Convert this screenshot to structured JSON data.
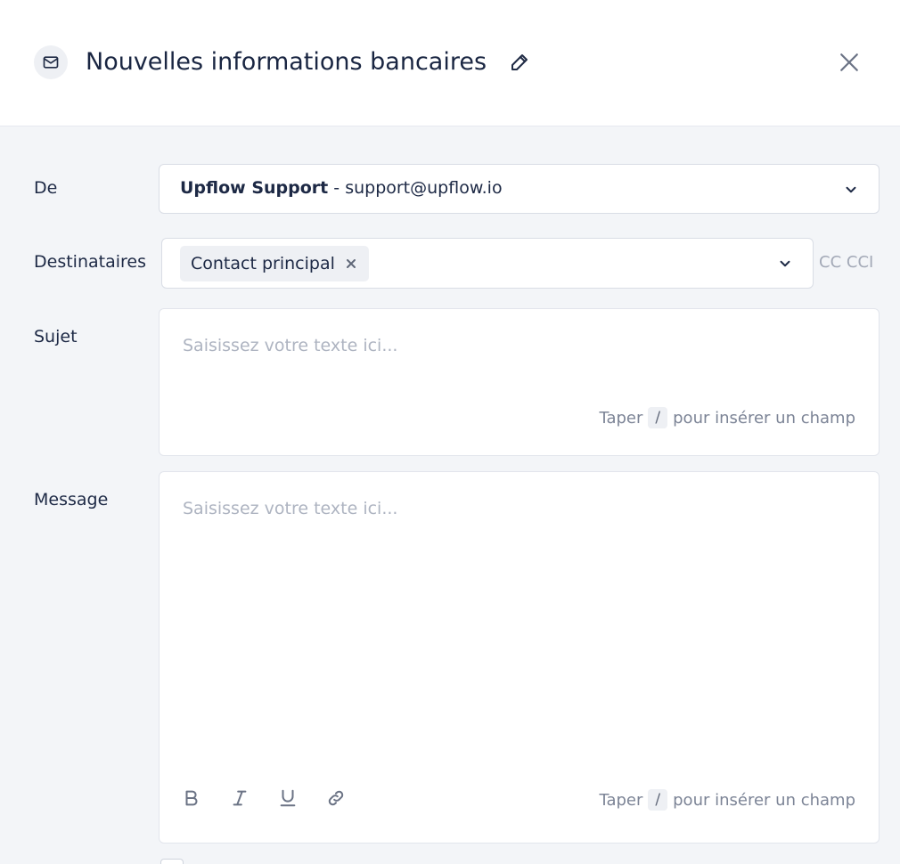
{
  "header": {
    "title": "Nouvelles informations bancaires",
    "icons": {
      "template": "mail-icon",
      "edit": "pencil-icon",
      "close": "close-icon"
    }
  },
  "form": {
    "from": {
      "label": "De",
      "sender_name": "Upflow Support",
      "separator": " - ",
      "sender_email": "support@upflow.io"
    },
    "recipients": {
      "label": "Destinataires",
      "chips": [
        "Contact principal"
      ],
      "cc_label": "CC",
      "bcc_label": "CCI"
    },
    "subject": {
      "label": "Sujet",
      "placeholder": "Saisissez votre texte ici...",
      "hint_before": "Taper",
      "hint_key": "/",
      "hint_after": "pour insérer un champ"
    },
    "message": {
      "label": "Message",
      "placeholder": "Saisissez votre texte ici...",
      "hint_before": "Taper",
      "hint_key": "/",
      "hint_after": "pour insérer un champ",
      "toolbar": [
        "bold-icon",
        "italic-icon",
        "underline-icon",
        "link-icon"
      ]
    }
  },
  "colors": {
    "background": "#f3f5f8",
    "header": "#ffffff",
    "text": "#1d2945",
    "muted": "#aeb4c1",
    "chip": "#eef0f4"
  }
}
